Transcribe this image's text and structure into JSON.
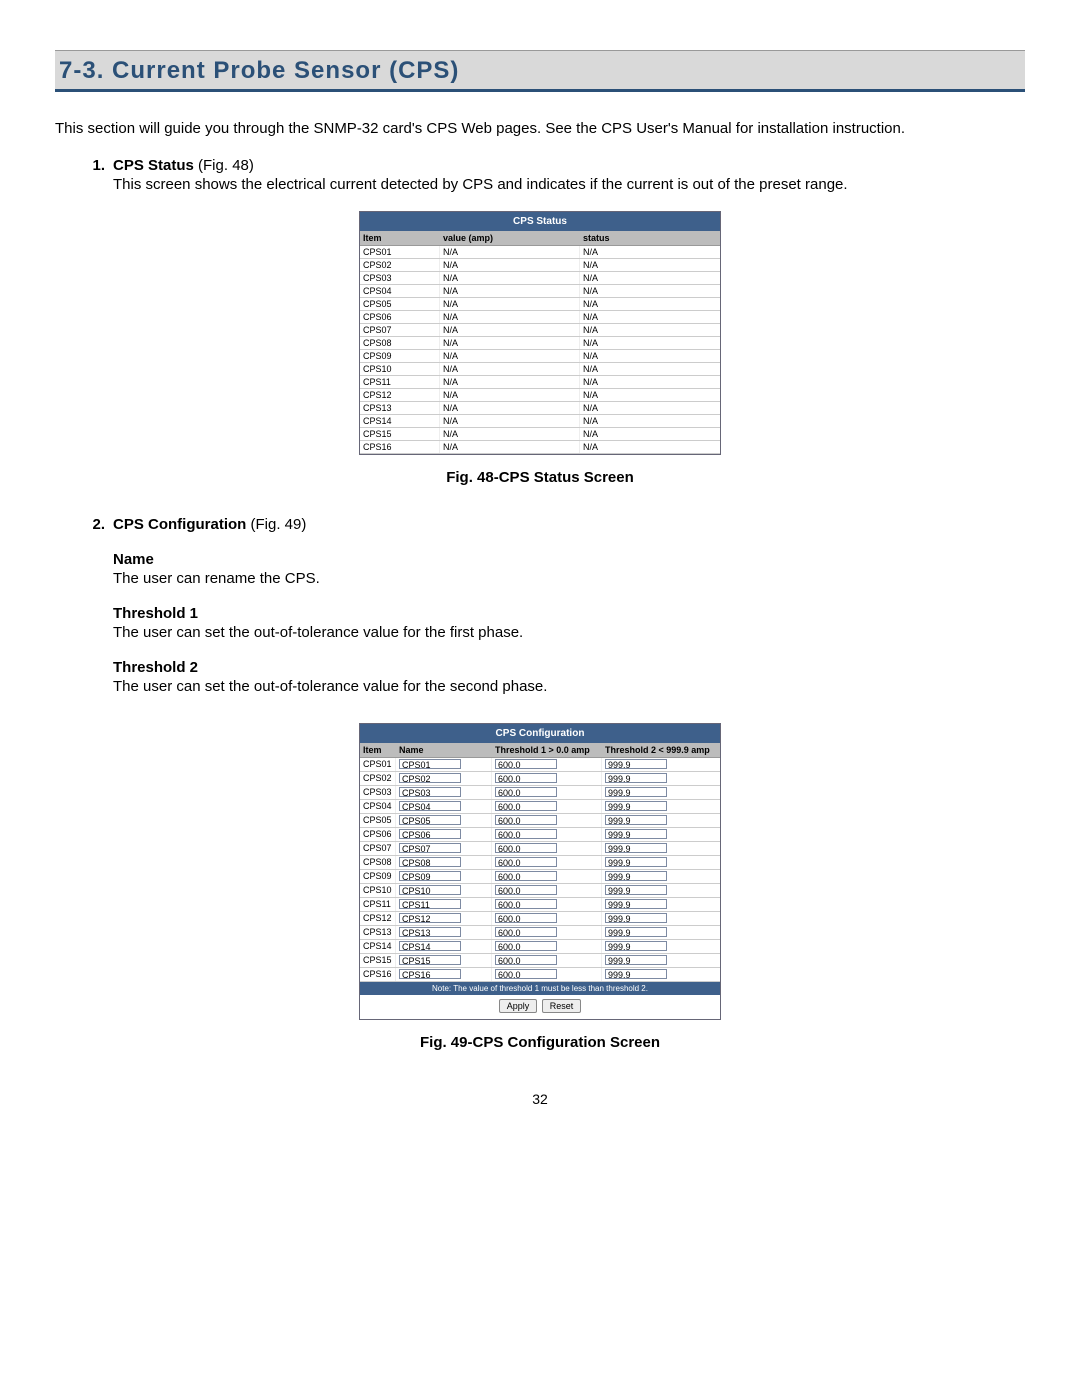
{
  "section_heading": "7-3.  Current Probe Sensor (CPS)",
  "intro_text": "This section will guide you through the SNMP-32 card's CPS Web pages.  See the CPS User's Manual for installation instruction.",
  "page_number": "32",
  "item1": {
    "number": "1.",
    "title_bold": "CPS Status",
    "title_rest": " (Fig. 48)",
    "desc": "This screen shows the electrical current detected by CPS and indicates if the current is out of the preset range."
  },
  "fig1_caption": "Fig. 48-CPS Status Screen",
  "item2": {
    "number": "2.",
    "title_bold": "CPS Configuration",
    "title_rest": " (Fig. 49)"
  },
  "sub_name": {
    "head": "Name",
    "text": "The user can rename the CPS."
  },
  "sub_th1": {
    "head": "Threshold 1",
    "text": "The user can set the out-of-tolerance value for the first phase."
  },
  "sub_th2": {
    "head": "Threshold 2",
    "text": "The user can set the out-of-tolerance value for the second phase."
  },
  "fig2_caption": "Fig. 49-CPS Configuration Screen",
  "status_screen": {
    "title": "CPS Status",
    "headers": {
      "c1": "Item",
      "c2": "value (amp)",
      "c3": "status"
    },
    "rows": [
      {
        "c1": "CPS01",
        "c2": "N/A",
        "c3": "N/A"
      },
      {
        "c1": "CPS02",
        "c2": "N/A",
        "c3": "N/A"
      },
      {
        "c1": "CPS03",
        "c2": "N/A",
        "c3": "N/A"
      },
      {
        "c1": "CPS04",
        "c2": "N/A",
        "c3": "N/A"
      },
      {
        "c1": "CPS05",
        "c2": "N/A",
        "c3": "N/A"
      },
      {
        "c1": "CPS06",
        "c2": "N/A",
        "c3": "N/A"
      },
      {
        "c1": "CPS07",
        "c2": "N/A",
        "c3": "N/A"
      },
      {
        "c1": "CPS08",
        "c2": "N/A",
        "c3": "N/A"
      },
      {
        "c1": "CPS09",
        "c2": "N/A",
        "c3": "N/A"
      },
      {
        "c1": "CPS10",
        "c2": "N/A",
        "c3": "N/A"
      },
      {
        "c1": "CPS11",
        "c2": "N/A",
        "c3": "N/A"
      },
      {
        "c1": "CPS12",
        "c2": "N/A",
        "c3": "N/A"
      },
      {
        "c1": "CPS13",
        "c2": "N/A",
        "c3": "N/A"
      },
      {
        "c1": "CPS14",
        "c2": "N/A",
        "c3": "N/A"
      },
      {
        "c1": "CPS15",
        "c2": "N/A",
        "c3": "N/A"
      },
      {
        "c1": "CPS16",
        "c2": "N/A",
        "c3": "N/A"
      }
    ]
  },
  "config_screen": {
    "title": "CPS Configuration",
    "headers": {
      "c1": "Item",
      "c2": "Name",
      "c3": "Threshold 1 > 0.0 amp",
      "c4": "Threshold 2 < 999.9 amp"
    },
    "note": "Note: The value of threshold 1 must be less than threshold 2.",
    "apply": "Apply",
    "reset": "Reset",
    "rows": [
      {
        "item": "CPS01",
        "name": "CPS01",
        "t1": "600.0",
        "t2": "999.9"
      },
      {
        "item": "CPS02",
        "name": "CPS02",
        "t1": "600.0",
        "t2": "999.9"
      },
      {
        "item": "CPS03",
        "name": "CPS03",
        "t1": "600.0",
        "t2": "999.9"
      },
      {
        "item": "CPS04",
        "name": "CPS04",
        "t1": "600.0",
        "t2": "999.9"
      },
      {
        "item": "CPS05",
        "name": "CPS05",
        "t1": "600.0",
        "t2": "999.9"
      },
      {
        "item": "CPS06",
        "name": "CPS06",
        "t1": "600.0",
        "t2": "999.9"
      },
      {
        "item": "CPS07",
        "name": "CPS07",
        "t1": "600.0",
        "t2": "999.9"
      },
      {
        "item": "CPS08",
        "name": "CPS08",
        "t1": "600.0",
        "t2": "999.9"
      },
      {
        "item": "CPS09",
        "name": "CPS09",
        "t1": "600.0",
        "t2": "999.9"
      },
      {
        "item": "CPS10",
        "name": "CPS10",
        "t1": "600.0",
        "t2": "999.9"
      },
      {
        "item": "CPS11",
        "name": "CPS11",
        "t1": "600.0",
        "t2": "999.9"
      },
      {
        "item": "CPS12",
        "name": "CPS12",
        "t1": "600.0",
        "t2": "999.9"
      },
      {
        "item": "CPS13",
        "name": "CPS13",
        "t1": "600.0",
        "t2": "999.9"
      },
      {
        "item": "CPS14",
        "name": "CPS14",
        "t1": "600.0",
        "t2": "999.9"
      },
      {
        "item": "CPS15",
        "name": "CPS15",
        "t1": "600.0",
        "t2": "999.9"
      },
      {
        "item": "CPS16",
        "name": "CPS16",
        "t1": "600.0",
        "t2": "999.9"
      }
    ]
  }
}
